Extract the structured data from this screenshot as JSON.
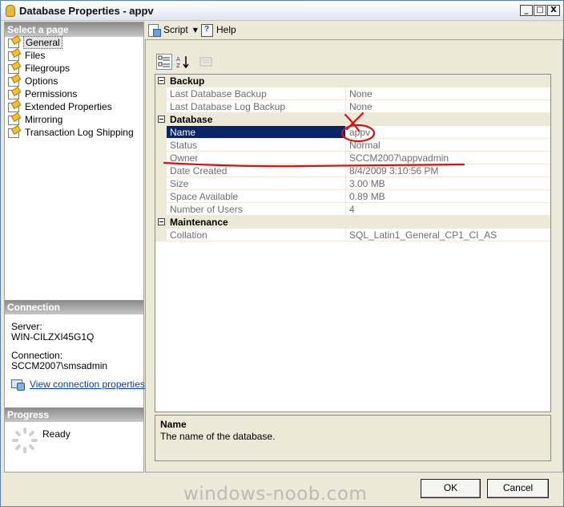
{
  "window": {
    "title": "Database Properties - appv",
    "controls": {
      "minimize": "_",
      "maximize": "□",
      "close": "X"
    }
  },
  "left_panel": {
    "select_page_header": "Select a page",
    "pages": [
      {
        "label": "General",
        "icon": "page-icon",
        "selected": true
      },
      {
        "label": "Files",
        "icon": "page-icon"
      },
      {
        "label": "Filegroups",
        "icon": "page-icon"
      },
      {
        "label": "Options",
        "icon": "page-icon"
      },
      {
        "label": "Permissions",
        "icon": "page-icon"
      },
      {
        "label": "Extended Properties",
        "icon": "page-icon"
      },
      {
        "label": "Mirroring",
        "icon": "page-icon"
      },
      {
        "label": "Transaction Log Shipping",
        "icon": "page-icon"
      }
    ],
    "connection_header": "Connection",
    "server_label": "Server:",
    "server_value": "WIN-CILZXI45G1Q",
    "connection_label": "Connection:",
    "connection_value": "SCCM2007\\smsadmin",
    "view_connection_link": "View connection properties",
    "progress_header": "Progress",
    "progress_status": "Ready"
  },
  "toolbar": {
    "script_label": "Script",
    "help_label": "Help"
  },
  "property_grid": {
    "toolbar_icons": [
      "categorized-icon",
      "alphabetical-icon",
      "property-pages-icon"
    ],
    "categories": [
      {
        "name": "Backup",
        "properties": [
          {
            "name": "Last Database Backup",
            "value": "None"
          },
          {
            "name": "Last Database Log Backup",
            "value": "None"
          }
        ]
      },
      {
        "name": "Database",
        "properties": [
          {
            "name": "Name",
            "value": "appv",
            "selected": true
          },
          {
            "name": "Status",
            "value": "Normal"
          },
          {
            "name": "Owner",
            "value": "SCCM2007\\appvadmin"
          },
          {
            "name": "Date Created",
            "value": "8/4/2009 3:10:56 PM"
          },
          {
            "name": "Size",
            "value": "3.00 MB"
          },
          {
            "name": "Space Available",
            "value": "0.89 MB"
          },
          {
            "name": "Number of Users",
            "value": "4"
          }
        ]
      },
      {
        "name": "Maintenance",
        "properties": [
          {
            "name": "Collation",
            "value": "SQL_Latin1_General_CP1_CI_AS"
          }
        ]
      }
    ]
  },
  "description": {
    "title": "Name",
    "text": "The name of the database."
  },
  "buttons": {
    "ok": "OK",
    "cancel": "Cancel"
  },
  "watermark": "windows-noob.com",
  "colors": {
    "selection": "#0a246a",
    "annotation": "#d81010",
    "link": "#0b3ea8"
  }
}
